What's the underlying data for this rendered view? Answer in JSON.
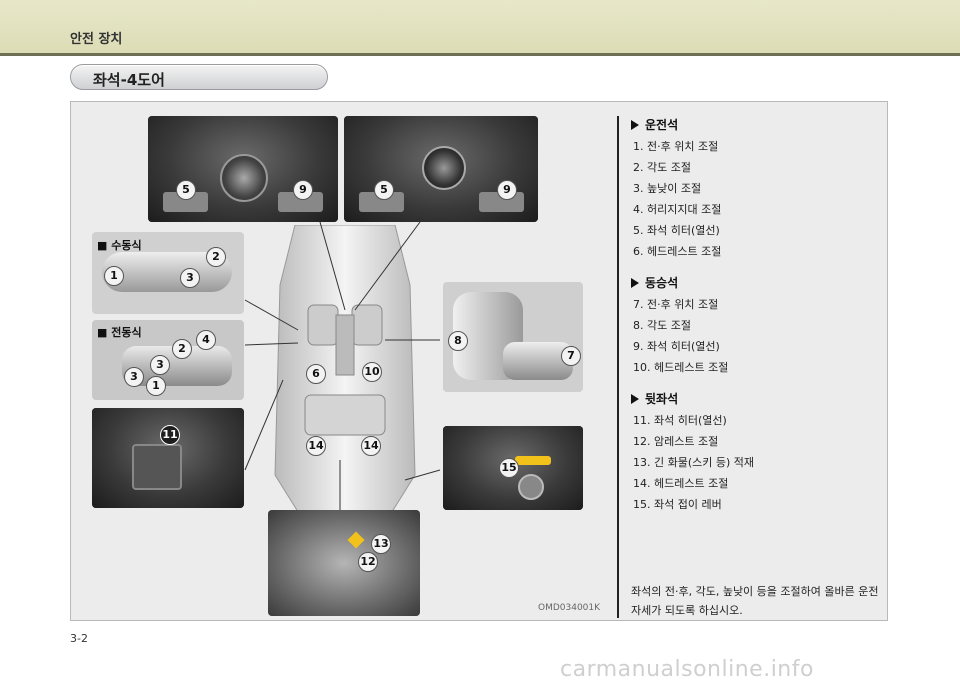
{
  "header": {
    "section": "안전 장치"
  },
  "title": "좌석-4도어",
  "figure": {
    "code": "OMD034001K",
    "manual_label": "■ 수동식",
    "power_label": "■ 전동식",
    "callouts": {
      "c5a": "5",
      "c9a": "9",
      "c5b": "5",
      "c9b": "9",
      "m2": "2",
      "m1": "1",
      "m3": "3",
      "p4": "4",
      "p2": "2",
      "p3a": "3",
      "p3b": "3",
      "p1": "1",
      "w11": "11",
      "s6": "6",
      "s10": "10",
      "s14a": "14",
      "s14b": "14",
      "r8": "8",
      "r7": "7",
      "r15": "15",
      "r13": "13",
      "r12": "12"
    }
  },
  "sections": [
    {
      "heading": "운전석",
      "items": [
        "1.  전·후 위치 조절",
        "2.  각도 조절",
        "3.  높낮이 조절",
        "4.  허리지지대 조절",
        "5.  좌석 히터(열선)",
        "6.  헤드레스트 조절"
      ]
    },
    {
      "heading": "동승석",
      "items": [
        "7.  전·후 위치 조절",
        "8.  각도 조절",
        "9.  좌석 히터(열선)",
        "10. 헤드레스트 조절"
      ]
    },
    {
      "heading": "뒷좌석",
      "items": [
        "11. 좌석 히터(열선)",
        "12. 암레스트 조절",
        "13. 긴 화물(스키 등) 적재",
        "14. 헤드레스트 조절",
        "15. 좌석 접이 레버"
      ]
    }
  ],
  "description": "좌석의 전·후, 각도, 높낮이 등을 조절하여 올바른 운전 자세가 되도록 하십시오.",
  "page": "3-2",
  "watermark": "carmanualsonline.info"
}
